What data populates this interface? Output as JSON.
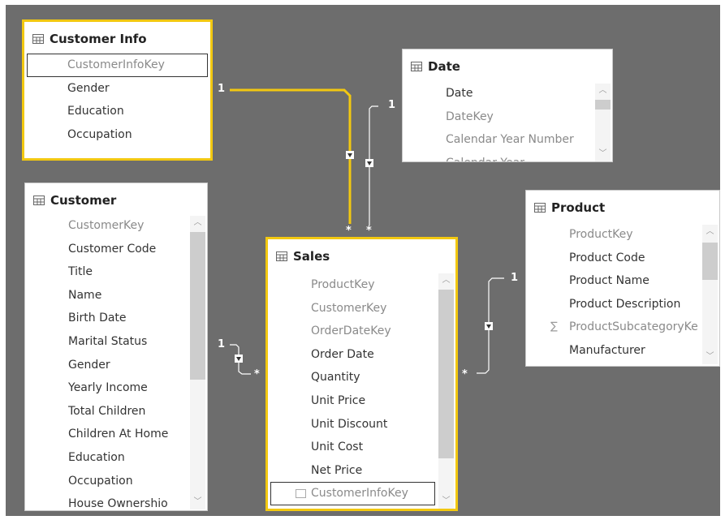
{
  "tables": {
    "customer_info": {
      "title": "Customer Info",
      "fields": [
        "CustomerInfoKey",
        "Gender",
        "Education",
        "Occupation"
      ]
    },
    "date": {
      "title": "Date",
      "fields": [
        "Date",
        "DateKey",
        "Calendar Year Number",
        "Calendar Year"
      ]
    },
    "customer": {
      "title": "Customer",
      "fields": [
        "CustomerKey",
        "Customer Code",
        "Title",
        "Name",
        "Birth Date",
        "Marital Status",
        "Gender",
        "Yearly Income",
        "Total Children",
        "Children At Home",
        "Education",
        "Occupation",
        "House Ownershio"
      ]
    },
    "sales": {
      "title": "Sales",
      "fields": [
        "ProductKey",
        "CustomerKey",
        "OrderDateKey",
        "Order Date",
        "Quantity",
        "Unit Price",
        "Unit Discount",
        "Unit Cost",
        "Net Price",
        "CustomerInfoKey"
      ]
    },
    "product": {
      "title": "Product",
      "fields": [
        "ProductKey",
        "Product Code",
        "Product Name",
        "Product Description",
        "ProductSubcategoryKe",
        "Manufacturer"
      ]
    }
  },
  "relationships": {
    "customerinfo_sales": {
      "one": "1",
      "many": "*"
    },
    "date_sales": {
      "one": "1",
      "many": "*"
    },
    "customer_sales": {
      "one": "1",
      "many": "*"
    },
    "product_sales": {
      "one": "1",
      "many": "*"
    }
  },
  "colors": {
    "canvas": "#6d6d6d",
    "highlight": "#f2c811",
    "hidden_text": "#8a8a8a",
    "text": "#333333"
  },
  "icons": {
    "table": "table-grid-icon",
    "sigma": "sigma-icon",
    "calculated": "calculated-column-icon"
  }
}
